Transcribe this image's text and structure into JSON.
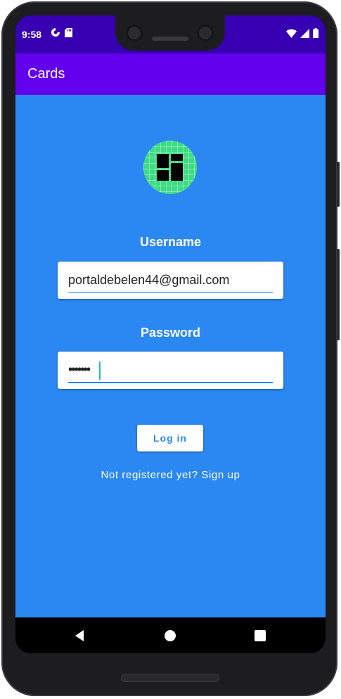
{
  "status_bar": {
    "time": "9:58",
    "left_icons": [
      "data-saver-icon",
      "sd-card-icon"
    ],
    "right_icons": [
      "wifi-icon",
      "signal-icon",
      "battery-icon"
    ]
  },
  "app_bar": {
    "title": "Cards"
  },
  "login": {
    "username_label": "Username",
    "username_value": "portaldebelen44@gmail.com",
    "password_label": "Password",
    "password_value": "•••••••",
    "login_button": "Log in",
    "signup_text": "Not registered yet? Sign up"
  },
  "nav_bar": {
    "buttons": [
      "back-icon",
      "home-icon",
      "recents-icon"
    ]
  },
  "colors": {
    "status_bar": "#3700b3",
    "app_bar": "#6200ee",
    "background": "#2b88f2",
    "logo": "#3ddc84",
    "cursor": "#19c3b5"
  }
}
